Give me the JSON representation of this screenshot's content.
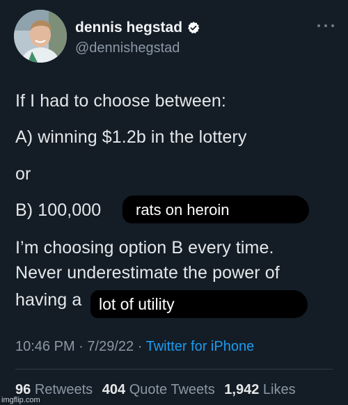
{
  "author": {
    "display_name": "dennis hegstad",
    "handle": "@dennishegstad",
    "verified_icon": "verified-badge-icon"
  },
  "tweet": {
    "lines": [
      "If I had to choose between:",
      "A) winning $1.2b in the lottery",
      "or",
      "B) 100,000",
      "I’m choosing option B every time.",
      "Never underestimate the power of",
      "having a"
    ],
    "overlay_1": "rats on heroin",
    "overlay_2": "lot of utility"
  },
  "meta": {
    "time": "10:46 PM",
    "date": "7/29/22",
    "source": "Twitter for iPhone",
    "separator": "·"
  },
  "stats": {
    "retweets_count": "96",
    "retweets_label": "Retweets",
    "quotes_count": "404",
    "quotes_label": "Quote Tweets",
    "likes_count": "1,942",
    "likes_label": "Likes"
  },
  "watermark": "imgflip.com",
  "colors": {
    "background": "#141d26",
    "link": "#1d9bf0",
    "muted": "#8b98a5",
    "verified": "#ffffff"
  }
}
